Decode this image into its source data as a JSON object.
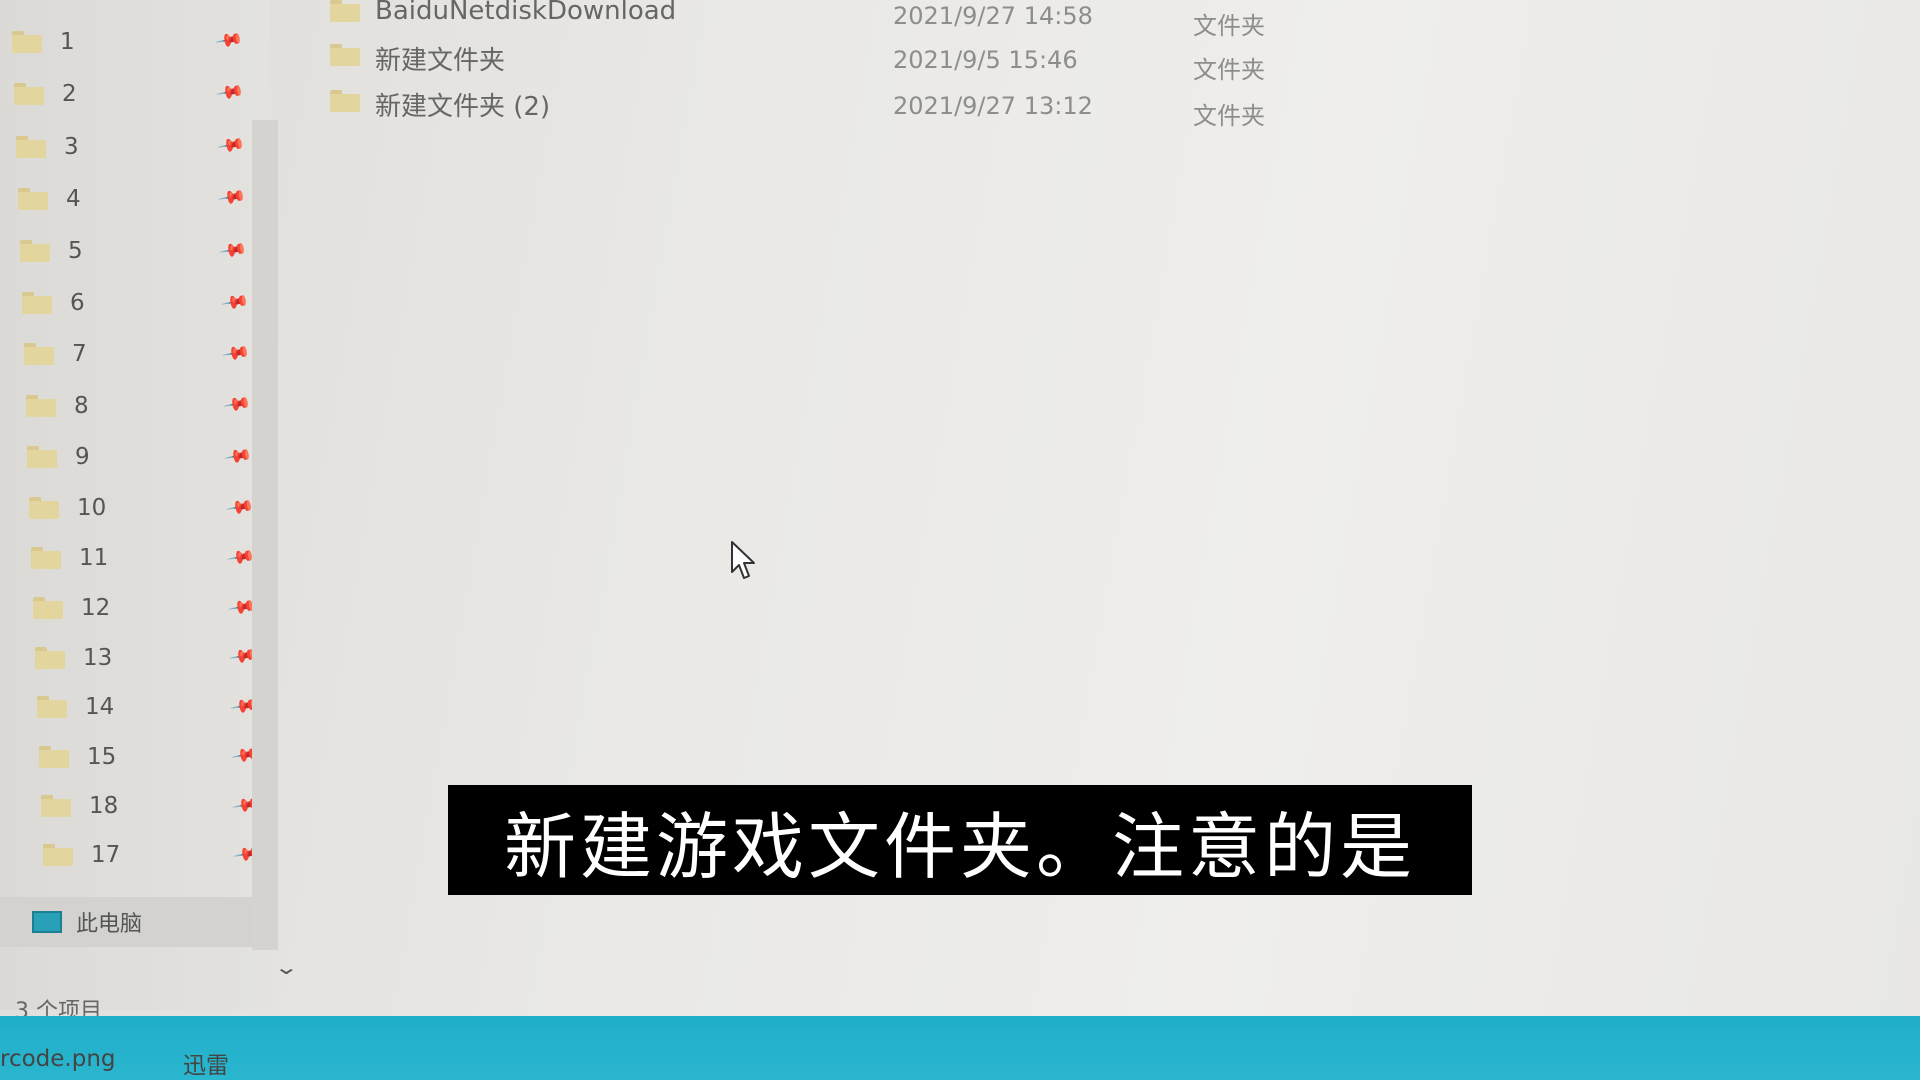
{
  "sidebar": {
    "items": [
      {
        "label": "1"
      },
      {
        "label": "2"
      },
      {
        "label": "3"
      },
      {
        "label": "4"
      },
      {
        "label": "5"
      },
      {
        "label": "6"
      },
      {
        "label": "7"
      },
      {
        "label": "8"
      },
      {
        "label": "9"
      },
      {
        "label": "10"
      },
      {
        "label": "11"
      },
      {
        "label": "12"
      },
      {
        "label": "13"
      },
      {
        "label": "14"
      },
      {
        "label": "15"
      },
      {
        "label": "18"
      },
      {
        "label": "17"
      }
    ],
    "this_pc_label": "此电脑"
  },
  "files": [
    {
      "name": "BaiduNetdiskDownload",
      "date": "2021/9/27 14:58",
      "type": "文件夹"
    },
    {
      "name": "新建文件夹",
      "date": "2021/9/5 15:46",
      "type": "文件夹"
    },
    {
      "name": "新建文件夹 (2)",
      "date": "2021/9/27 13:12",
      "type": "文件夹"
    }
  ],
  "status": {
    "item_count": "3 个项目"
  },
  "taskbar": {
    "items": [
      {
        "label": "rcode.png"
      },
      {
        "label": "迅雷"
      }
    ]
  },
  "subtitle": {
    "text": "新建游戏文件夹。注意的是"
  },
  "icons": {
    "pin": "pin-icon",
    "folder": "folder-icon",
    "this_pc": "computer-icon",
    "cursor": "mouse-cursor-icon"
  },
  "colors": {
    "taskbar": "#1faec9",
    "folder": "#e3d59e",
    "subtitle_bg": "#000000"
  }
}
